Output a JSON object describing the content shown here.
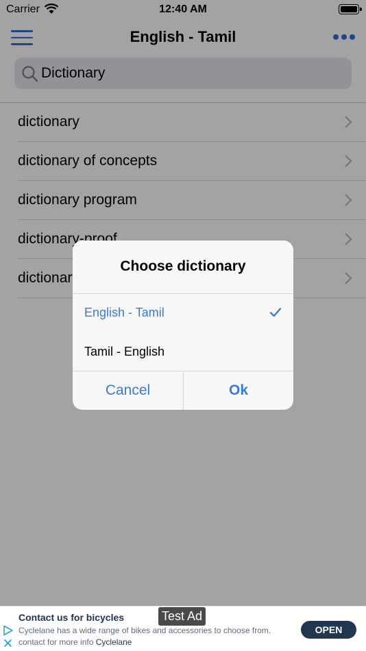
{
  "status_bar": {
    "carrier": "Carrier",
    "time": "12:40 AM"
  },
  "nav": {
    "title": "English - Tamil",
    "menu_icon": "hamburger-icon",
    "more_icon": "ellipsis-icon"
  },
  "search": {
    "value": "Dictionary",
    "icon": "search-icon"
  },
  "results": [
    {
      "label": "dictionary"
    },
    {
      "label": "dictionary of concepts"
    },
    {
      "label": "dictionary program"
    },
    {
      "label": "dictionary-proof"
    },
    {
      "label": "dictionary"
    }
  ],
  "dialog": {
    "title": "Choose dictionary",
    "options": [
      {
        "label": "English - Tamil",
        "selected": true
      },
      {
        "label": "Tamil - English",
        "selected": false
      }
    ],
    "cancel_label": "Cancel",
    "ok_label": "Ok"
  },
  "ad": {
    "badge": "Test Ad",
    "headline": "Contact us for bicycles",
    "body": "Cyclelane has a wide range of bikes and accessories to choose from. contact for more info",
    "advertiser": "Cyclelane",
    "cta": "OPEN"
  },
  "colors": {
    "accent": "#3a7bd5",
    "ad_button": "#203750"
  }
}
